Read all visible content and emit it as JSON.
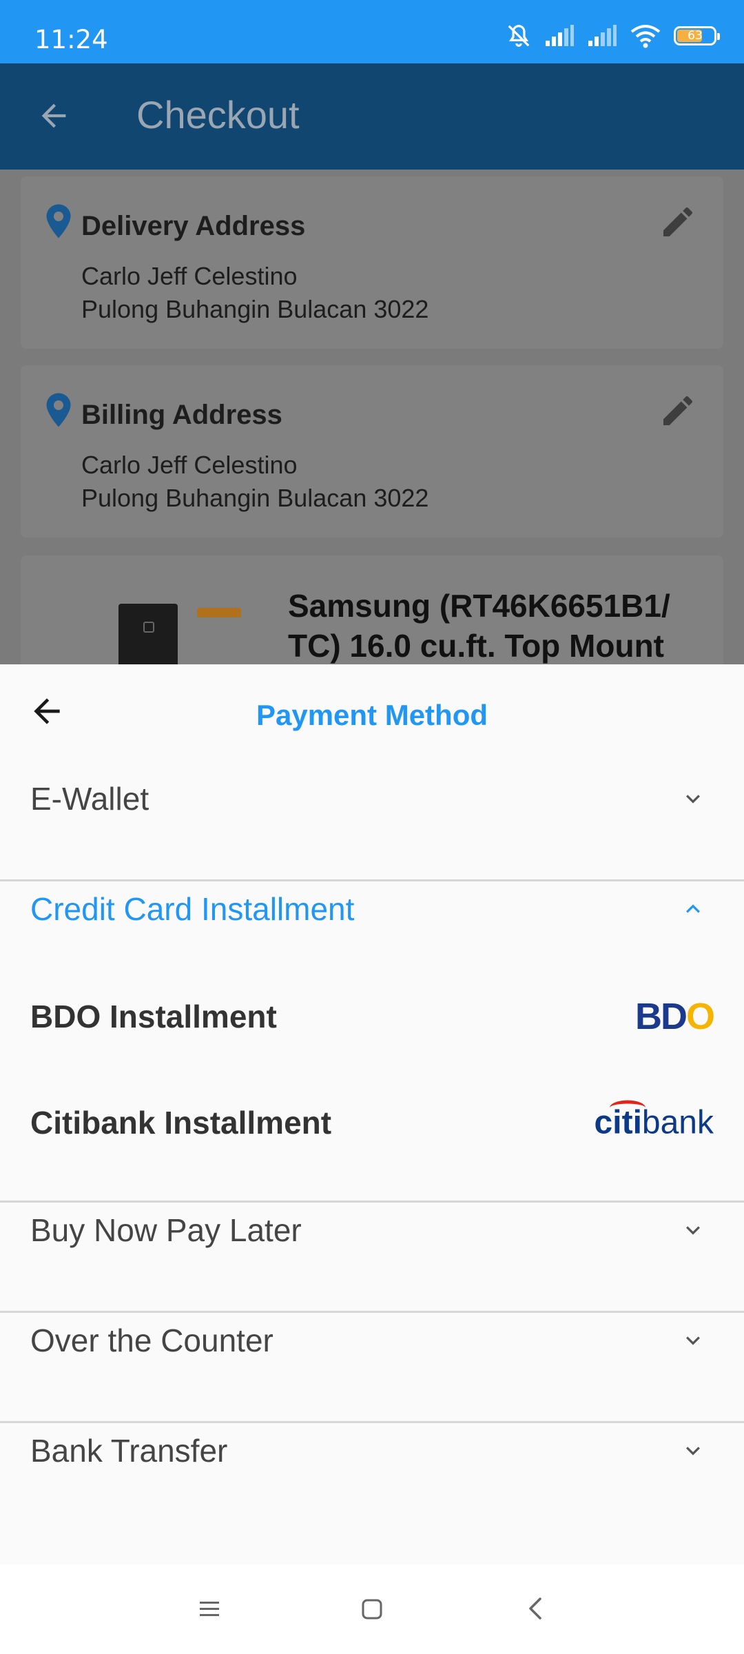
{
  "status_bar": {
    "time": "11:24",
    "battery_level": "63",
    "icons": [
      "mute-icon",
      "signal-icon",
      "signal-icon",
      "wifi-icon",
      "battery-icon"
    ]
  },
  "app_bar": {
    "title": "Checkout"
  },
  "delivery_address": {
    "title": "Delivery Address",
    "name": "Carlo Jeff Celestino",
    "address": "Pulong Buhangin Bulacan 3022"
  },
  "billing_address": {
    "title": "Billing Address",
    "name": "Carlo Jeff Celestino",
    "address": "Pulong Buhangin Bulacan 3022"
  },
  "product": {
    "name": "Samsung (RT46K6651B1/ TC) 16.0 cu.ft. Top Mount"
  },
  "payment_sheet": {
    "title": "Payment Method",
    "sections": [
      {
        "label": "E-Wallet",
        "expanded": false
      },
      {
        "label": "Credit Card Installment",
        "expanded": true,
        "options": [
          {
            "label": "BDO Installment",
            "logo": "BDO"
          },
          {
            "label": "Citibank Installment",
            "logo": "citibank"
          }
        ]
      },
      {
        "label": "Buy Now Pay Later",
        "expanded": false
      },
      {
        "label": "Over the Counter",
        "expanded": false
      },
      {
        "label": "Bank Transfer",
        "expanded": false
      }
    ]
  },
  "logos": {
    "bdo_b": "B",
    "bdo_d": "D",
    "bdo_o": "O",
    "citi_a": "citi",
    "citi_b": "bank"
  },
  "colors": {
    "accent": "#2196f3",
    "status_bar": "#2196f3",
    "app_bar_dimmed": "#114670",
    "bdo_blue": "#1b3a8c",
    "bdo_yellow": "#f5b400",
    "citi_blue": "#0d3a88",
    "citi_red": "#e0251b"
  }
}
